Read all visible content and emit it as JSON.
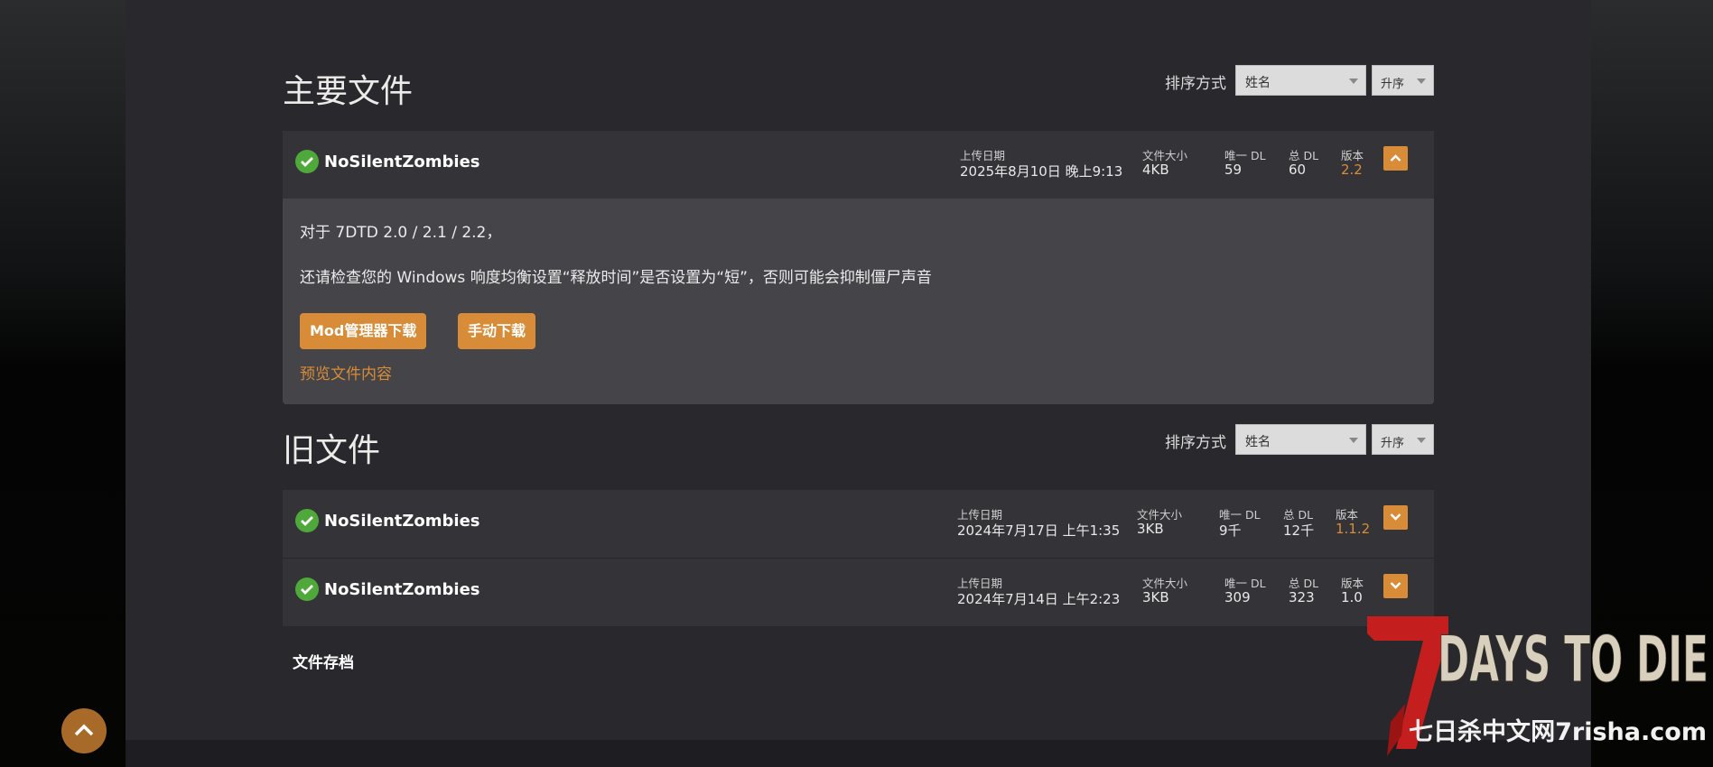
{
  "main_files": {
    "title": "主要文件",
    "sort": {
      "label": "排序方式",
      "field": "姓名",
      "order": "升序"
    },
    "files": [
      {
        "name": "NoSilentZombies",
        "upload_label": "上传日期",
        "upload_date": "2025年8月10日 晚上9:13",
        "size_label": "文件大小",
        "size": "4KB",
        "unique_label": "唯一 DL",
        "unique": "59",
        "total_label": "总 DL",
        "total": "60",
        "version_label": "版本",
        "version": "2.2",
        "description": [
          "对于 7DTD 2.0 / 2.1 / 2.2，",
          "还请检查您的 Windows 响度均衡设置“释放时间”是否设置为“短”，否则可能会抑制僵尸声音"
        ],
        "mod_manager_button": "Mod管理器下载",
        "manual_button": "手动下载",
        "preview_link": "预览文件内容"
      }
    ]
  },
  "old_files": {
    "title": "旧文件",
    "sort": {
      "label": "排序方式",
      "field": "姓名",
      "order": "升序"
    },
    "files": [
      {
        "name": "NoSilentZombies",
        "upload_label": "上传日期",
        "upload_date": "2024年7月17日 上午1:35",
        "size_label": "文件大小",
        "size": "3KB",
        "unique_label": "唯一 DL",
        "unique": "9千",
        "total_label": "总 DL",
        "total": "12千",
        "version_label": "版本",
        "version": "1.1.2"
      },
      {
        "name": "NoSilentZombies",
        "upload_label": "上传日期",
        "upload_date": "2024年7月14日 上午2:23",
        "size_label": "文件大小",
        "size": "3KB",
        "unique_label": "唯一 DL",
        "unique": "309",
        "total_label": "总 DL",
        "total": "323",
        "version_label": "版本",
        "version": "1.0"
      }
    ]
  },
  "archive_link": "文件存档",
  "watermark": {
    "logo": "7 DAYS TO DIE",
    "site": "七日杀中文网7risha.com"
  },
  "colors": {
    "accent": "#d98c37",
    "check": "#4ea93a",
    "panel": "#28282d"
  }
}
